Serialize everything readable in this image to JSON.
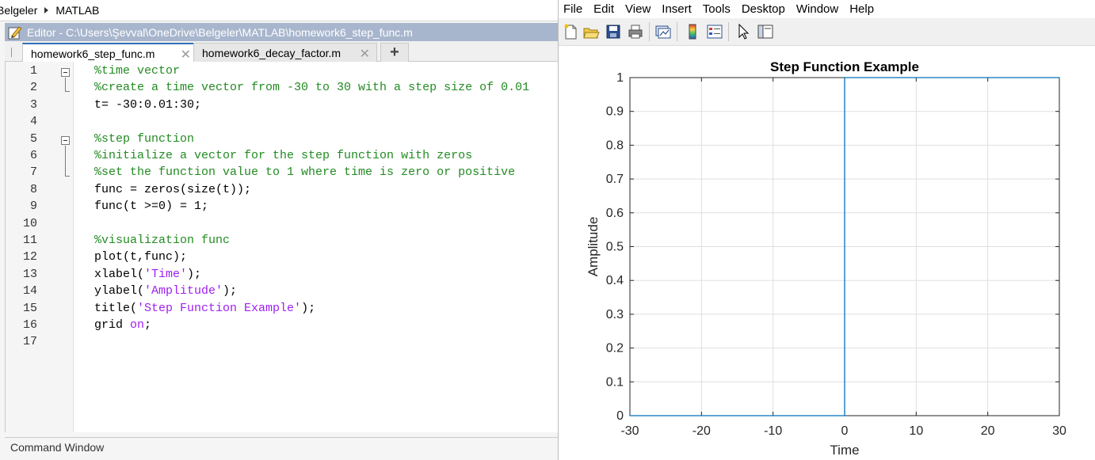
{
  "breadcrumb": {
    "items": [
      "Belgeler",
      "MATLAB"
    ]
  },
  "editor": {
    "title": "Editor - C:\\Users\\Şevval\\OneDrive\\Belgeler\\MATLAB\\homework6_step_func.m",
    "tabs": [
      {
        "label": "homework6_step_func.m",
        "active": true,
        "close": "✕"
      },
      {
        "label": "homework6_decay_factor.m",
        "active": false,
        "close": "✕"
      }
    ],
    "add_tab": "+",
    "line_numbers": [
      "1",
      "2",
      "3",
      "4",
      "5",
      "6",
      "7",
      "8",
      "9",
      "10",
      "11",
      "12",
      "13",
      "14",
      "15",
      "16",
      "17"
    ],
    "code_lines": [
      [
        {
          "t": "%time vector",
          "c": "cmt"
        }
      ],
      [
        {
          "t": "%create a time vector from -30 to 30 with a step size of 0.01",
          "c": "cmt"
        }
      ],
      [
        {
          "t": "t= -30:0.01:30;",
          "c": ""
        }
      ],
      [],
      [
        {
          "t": "%step function",
          "c": "cmt"
        }
      ],
      [
        {
          "t": "%initialize a vector for the step function with zeros",
          "c": "cmt"
        }
      ],
      [
        {
          "t": "%set the function value to 1 where time is zero or positive",
          "c": "cmt"
        }
      ],
      [
        {
          "t": "func = zeros(size(t));",
          "c": ""
        }
      ],
      [
        {
          "t": "func(t >=0) = 1;",
          "c": ""
        }
      ],
      [],
      [
        {
          "t": "%visualization func",
          "c": "cmt"
        }
      ],
      [
        {
          "t": "plot(t,func);",
          "c": ""
        }
      ],
      [
        {
          "t": "xlabel(",
          "c": ""
        },
        {
          "t": "'Time'",
          "c": "str"
        },
        {
          "t": ");",
          "c": ""
        }
      ],
      [
        {
          "t": "ylabel(",
          "c": ""
        },
        {
          "t": "'Amplitude'",
          "c": "str"
        },
        {
          "t": ");",
          "c": ""
        }
      ],
      [
        {
          "t": "title(",
          "c": ""
        },
        {
          "t": "'Step Function Example'",
          "c": "str"
        },
        {
          "t": ");",
          "c": ""
        }
      ],
      [
        {
          "t": "grid ",
          "c": ""
        },
        {
          "t": "on",
          "c": "str"
        },
        {
          "t": ";",
          "c": ""
        }
      ],
      []
    ]
  },
  "command_window": {
    "label": "Command Window"
  },
  "figure": {
    "menu": [
      "File",
      "Edit",
      "View",
      "Insert",
      "Tools",
      "Desktop",
      "Window",
      "Help"
    ],
    "toolbar_icons": [
      "new-figure-icon",
      "open-file-icon",
      "save-icon",
      "print-icon",
      "link-plot-icon",
      "insert-colorbar-icon",
      "insert-legend-icon",
      "edit-plot-cursor-icon",
      "plot-tools-icon"
    ]
  },
  "chart_data": {
    "type": "line",
    "title": "Step Function Example",
    "xlabel": "Time",
    "ylabel": "Amplitude",
    "xlim": [
      -30,
      30
    ],
    "ylim": [
      0,
      1
    ],
    "xticks": [
      -30,
      -20,
      -10,
      0,
      10,
      20,
      30
    ],
    "yticks": [
      0,
      0.1,
      0.2,
      0.3,
      0.4,
      0.5,
      0.6,
      0.7,
      0.8,
      0.9,
      1
    ],
    "grid": true,
    "line_color": "#0072bd",
    "series": [
      {
        "x": [
          -30,
          0,
          0,
          30
        ],
        "y": [
          0,
          0,
          1,
          1
        ]
      }
    ]
  }
}
